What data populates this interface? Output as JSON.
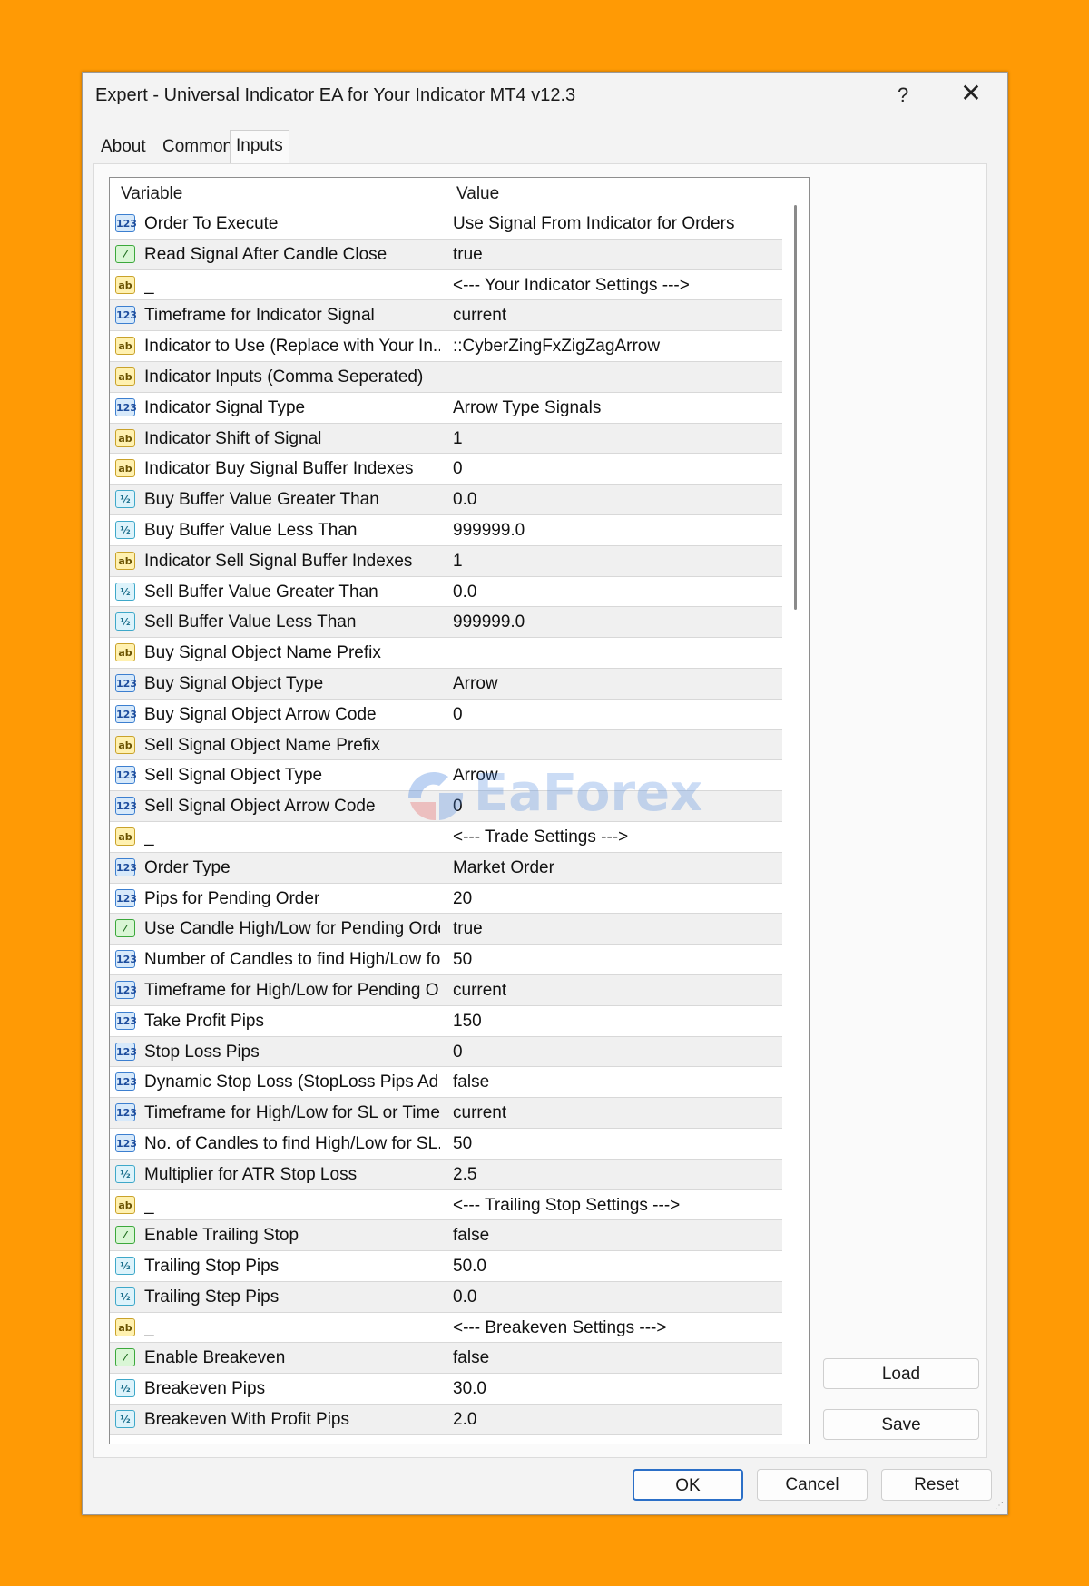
{
  "window": {
    "title": "Expert - Universal Indicator EA for Your Indicator MT4 v12.3",
    "help": "?",
    "close": "✕"
  },
  "tabs": [
    {
      "label": "About"
    },
    {
      "label": "Common"
    },
    {
      "label": "Inputs",
      "active": true
    }
  ],
  "grid": {
    "col_variable": "Variable",
    "col_value": "Value",
    "rows": [
      {
        "type": "int",
        "variable": "Order To Execute",
        "value": "Use Signal From Indicator for Orders"
      },
      {
        "type": "bool",
        "variable": "Read Signal After Candle Close",
        "value": "true"
      },
      {
        "type": "str",
        "variable": "_",
        "value": "<--- Your Indicator Settings --->"
      },
      {
        "type": "int",
        "variable": "Timeframe for Indicator Signal",
        "value": "current"
      },
      {
        "type": "str",
        "variable": "Indicator to Use (Replace with Your In...",
        "value": "::CyberZingFxZigZagArrow"
      },
      {
        "type": "str",
        "variable": "Indicator Inputs (Comma Seperated)",
        "value": ""
      },
      {
        "type": "int",
        "variable": "Indicator Signal Type",
        "value": "Arrow Type Signals"
      },
      {
        "type": "str",
        "variable": "Indicator Shift of Signal",
        "value": "1"
      },
      {
        "type": "str",
        "variable": "Indicator Buy Signal Buffer Indexes",
        "value": "0"
      },
      {
        "type": "dbl",
        "variable": "Buy Buffer Value Greater Than",
        "value": "0.0"
      },
      {
        "type": "dbl",
        "variable": "Buy Buffer Value Less Than",
        "value": "999999.0"
      },
      {
        "type": "str",
        "variable": "Indicator Sell Signal Buffer Indexes",
        "value": "1"
      },
      {
        "type": "dbl",
        "variable": "Sell Buffer Value Greater Than",
        "value": "0.0"
      },
      {
        "type": "dbl",
        "variable": "Sell Buffer Value Less Than",
        "value": "999999.0"
      },
      {
        "type": "str",
        "variable": "Buy Signal Object Name Prefix",
        "value": ""
      },
      {
        "type": "int",
        "variable": "Buy Signal Object Type",
        "value": "Arrow"
      },
      {
        "type": "int",
        "variable": "Buy Signal Object Arrow Code",
        "value": "0"
      },
      {
        "type": "str",
        "variable": "Sell Signal Object Name Prefix",
        "value": ""
      },
      {
        "type": "int",
        "variable": "Sell Signal Object Type",
        "value": "Arrow"
      },
      {
        "type": "int",
        "variable": "Sell Signal Object Arrow Code",
        "value": "0"
      },
      {
        "type": "str",
        "variable": "_",
        "value": "<--- Trade Settings --->"
      },
      {
        "type": "int",
        "variable": "Order Type",
        "value": "Market Order"
      },
      {
        "type": "int",
        "variable": "Pips for Pending Order",
        "value": "20"
      },
      {
        "type": "bool",
        "variable": "Use Candle High/Low for Pending Order",
        "value": "true"
      },
      {
        "type": "int",
        "variable": "Number of Candles to find High/Low fo...",
        "value": "50"
      },
      {
        "type": "int",
        "variable": "Timeframe for High/Low for Pending O...",
        "value": "current"
      },
      {
        "type": "int",
        "variable": "Take Profit Pips",
        "value": "150"
      },
      {
        "type": "int",
        "variable": "Stop Loss Pips",
        "value": "0"
      },
      {
        "type": "int",
        "variable": "Dynamic Stop Loss (StopLoss Pips Ad...",
        "value": "false"
      },
      {
        "type": "int",
        "variable": "Timeframe for High/Low for SL or Time...",
        "value": "current"
      },
      {
        "type": "int",
        "variable": "No. of Candles to find High/Low for SL...",
        "value": "50"
      },
      {
        "type": "dbl",
        "variable": "Multiplier for ATR Stop Loss",
        "value": "2.5"
      },
      {
        "type": "str",
        "variable": "_",
        "value": "<--- Trailing Stop Settings --->"
      },
      {
        "type": "bool",
        "variable": "Enable Trailing Stop",
        "value": "false"
      },
      {
        "type": "dbl",
        "variable": "Trailing Stop Pips",
        "value": "50.0"
      },
      {
        "type": "dbl",
        "variable": "Trailing Step Pips",
        "value": "0.0"
      },
      {
        "type": "str",
        "variable": "_",
        "value": "<--- Breakeven Settings --->"
      },
      {
        "type": "bool",
        "variable": "Enable Breakeven",
        "value": "false"
      },
      {
        "type": "dbl",
        "variable": "Breakeven Pips",
        "value": "30.0"
      },
      {
        "type": "dbl",
        "variable": "Breakeven With Profit Pips",
        "value": "2.0"
      }
    ]
  },
  "icon_glyphs": {
    "int": "123",
    "str": "ab",
    "bool": "⁄",
    "dbl": "½"
  },
  "side_buttons": {
    "load": "Load",
    "save": "Save"
  },
  "buttons": {
    "ok": "OK",
    "cancel": "Cancel",
    "reset": "Reset"
  },
  "watermark": {
    "text": "EaForex"
  }
}
